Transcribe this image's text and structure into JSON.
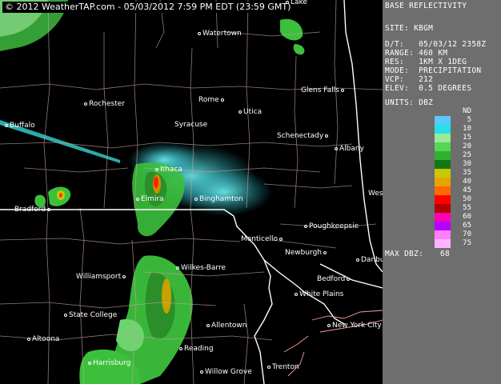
{
  "header": {
    "timestamp": "© 2012 WeatherTAP.com - 05/03/2012  7:59 PM EDT (23:59 GMT)"
  },
  "panel": {
    "title": "BASE REFLECTIVITY",
    "site": "SITE: KBGM",
    "date_time": "D/T:   05/03/12 2358Z",
    "range": "RANGE: 460 KM",
    "res": "RES:   1KM X 1DEG",
    "mode": "MODE:  PRECIPITATION",
    "vcp": "VCP:   212",
    "elev": "ELEV:  0.5 DEGREES",
    "units": "UNITS: DBZ",
    "max_dbz_label": "MAX DBZ:",
    "max_dbz_value": "68"
  },
  "legend": [
    {
      "label": "ND",
      "color": "#6e6e6e"
    },
    {
      "label": "5",
      "color": "#58c9ff"
    },
    {
      "label": "10",
      "color": "#27e0e6"
    },
    {
      "label": "15",
      "color": "#9ce89c"
    },
    {
      "label": "20",
      "color": "#55d655"
    },
    {
      "label": "25",
      "color": "#2fb02f"
    },
    {
      "label": "30",
      "color": "#137813"
    },
    {
      "label": "35",
      "color": "#c8c800"
    },
    {
      "label": "40",
      "color": "#e6a400"
    },
    {
      "label": "45",
      "color": "#ff6a00"
    },
    {
      "label": "50",
      "color": "#ff0000"
    },
    {
      "label": "55",
      "color": "#b40000"
    },
    {
      "label": "60",
      "color": "#ff00b4"
    },
    {
      "label": "65",
      "color": "#b400ff"
    },
    {
      "label": "70",
      "color": "#ff80ff"
    },
    {
      "label": "75",
      "color": "#ffb4ff"
    }
  ],
  "cities": [
    {
      "name": "Watertown",
      "dot": "left"
    },
    {
      "name": "Lake",
      "dot": "left"
    },
    {
      "name": "Rochester",
      "dot": "left"
    },
    {
      "name": "Rome",
      "dot": "right"
    },
    {
      "name": "Utica",
      "dot": "left"
    },
    {
      "name": "Glens Falls",
      "dot": "right"
    },
    {
      "name": "Syracuse",
      "dot": "none"
    },
    {
      "name": "Buffalo",
      "dot": "left"
    },
    {
      "name": "Schenectady",
      "dot": "right"
    },
    {
      "name": "Albany",
      "dot": "left"
    },
    {
      "name": "Ithaca",
      "dot": "left"
    },
    {
      "name": "Elmira",
      "dot": "left"
    },
    {
      "name": "Binghamton",
      "dot": "left"
    },
    {
      "name": "Bradford",
      "dot": "right"
    },
    {
      "name": "Poughkeepsie",
      "dot": "left"
    },
    {
      "name": "Monticello",
      "dot": "right"
    },
    {
      "name": "Newburgh",
      "dot": "right"
    },
    {
      "name": "Danbu",
      "dot": "left"
    },
    {
      "name": "Williamsport",
      "dot": "right"
    },
    {
      "name": "Wilkes-Barre",
      "dot": "left"
    },
    {
      "name": "Bedford",
      "dot": "right"
    },
    {
      "name": "White Plains",
      "dot": "left"
    },
    {
      "name": "State College",
      "dot": "left"
    },
    {
      "name": "Allentown",
      "dot": "left"
    },
    {
      "name": "New York City",
      "dot": "left"
    },
    {
      "name": "Altoona",
      "dot": "left"
    },
    {
      "name": "Reading",
      "dot": "left"
    },
    {
      "name": "Harrisburg",
      "dot": "left"
    },
    {
      "name": "Willow Grove",
      "dot": "left"
    },
    {
      "name": "Trenton",
      "dot": "left"
    },
    {
      "name": "Wes",
      "dot": "none"
    }
  ]
}
